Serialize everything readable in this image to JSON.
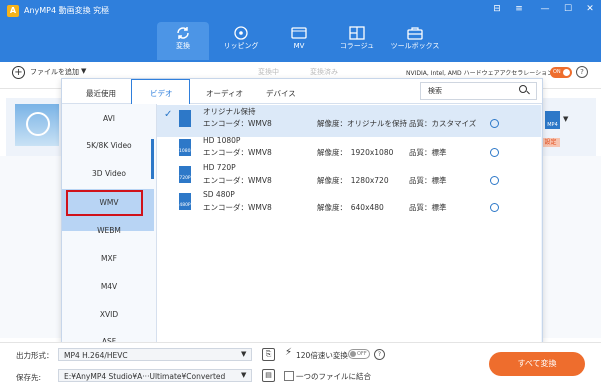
{
  "app": {
    "title": "AnyMP4 動画変換 究極",
    "logo_letter": "A"
  },
  "window_controls": [
    "⊟",
    "≡",
    "—",
    "☐",
    "✕"
  ],
  "main_tabs": [
    {
      "label": "変換"
    },
    {
      "label": "リッピング"
    },
    {
      "label": "MV"
    },
    {
      "label": "コラージュ"
    },
    {
      "label": "ツールボックス"
    }
  ],
  "subbar": {
    "add_file": "ファイルを追加",
    "add_file_arrow": "▼",
    "tab_converting": "変換中",
    "tab_converted": "変換済み",
    "hw_accel": "NVIDIA, Intel, AMD ハードウェアアクセラレーション",
    "hw_toggle": "ON",
    "info": "?"
  },
  "file_row": {
    "format_badge": "MP4",
    "settings_badge": "設定"
  },
  "popup": {
    "tabs": [
      "最近使用",
      "ビデオ",
      "オーディオ",
      "デバイス"
    ],
    "active_tab": "ビデオ",
    "search_placeholder": "検索",
    "formats": [
      "AVI",
      "5K/8K Video",
      "3D Video",
      "WMV",
      "WEBM",
      "MXF",
      "M4V",
      "XVID",
      "ASF"
    ],
    "selected_format": "WMV",
    "presets": [
      {
        "name": "オリジナル保持",
        "icon_text": "",
        "encoder": "エンコーダ：WMV8",
        "resolution": "解像度：オリジナルを保持",
        "quality": "品質：カスタマイズ"
      },
      {
        "name": "HD 1080P",
        "icon_text": "1080P",
        "encoder": "エンコーダ：WMV8",
        "resolution": "解像度：　1920x1080",
        "quality": "品質：標準"
      },
      {
        "name": "HD 720P",
        "icon_text": "720P",
        "encoder": "エンコーダ：WMV8",
        "resolution": "解像度：　1280x720",
        "quality": "品質：標準"
      },
      {
        "name": "SD 480P",
        "icon_text": "480P",
        "encoder": "エンコーダ：WMV8",
        "resolution": "解像度：　640x480",
        "quality": "品質：標準"
      }
    ],
    "check": "✓"
  },
  "bottom": {
    "output_label": "出力形式：",
    "output_value": "MP4 H.264/HEVC",
    "speed_label": "120倍速い変換",
    "speed_toggle": "OFF",
    "save_label": "保存先:",
    "save_path": "E:¥AnyMP4 Studio¥A···Ultimate¥Converted",
    "merge_label": "一つのファイルに結合",
    "convert_all": "すべて変換",
    "arrow": "▼"
  },
  "colors": {
    "accent": "#2f7fdc",
    "orange": "#ee6d2d",
    "highlight_red": "#d0121a"
  }
}
